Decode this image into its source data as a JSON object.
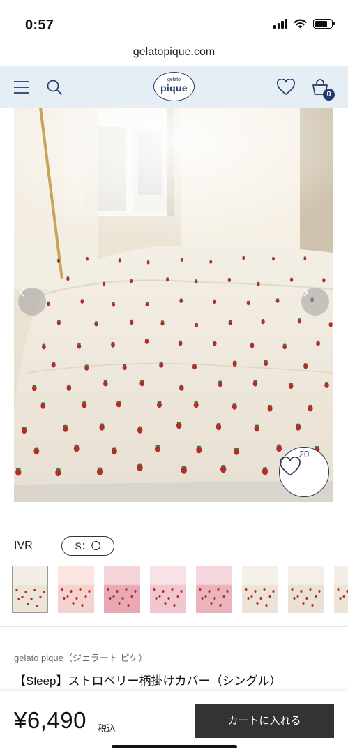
{
  "status": {
    "time": "0:57"
  },
  "browser": {
    "url": "gelatopique.com"
  },
  "header": {
    "logo_small": "gelato",
    "logo_big": "pique",
    "cart_count": "0",
    "icons": [
      "menu-icon",
      "search-icon",
      "heart-icon",
      "cart-icon"
    ]
  },
  "hero": {
    "favorite_count": "20",
    "prev_icon": "chevron-left-icon",
    "next_icon": "chevron-right-icon"
  },
  "options": {
    "color_label": "IVR",
    "size_option": "S：〇"
  },
  "thumbnails_count": 8,
  "product": {
    "brand": "gelato pique（ジェラート ピケ）",
    "title": "【Sleep】ストロベリー柄掛けカバー（シングル）"
  },
  "purchase": {
    "price": "¥6,490",
    "tax_label": "税込",
    "cart_button": "カートに入れる"
  },
  "colors": {
    "header_bg": "#e5eef4",
    "brand_navy": "#253a6e",
    "button_dark": "#333333",
    "strawberry_red": "#b8292c"
  }
}
